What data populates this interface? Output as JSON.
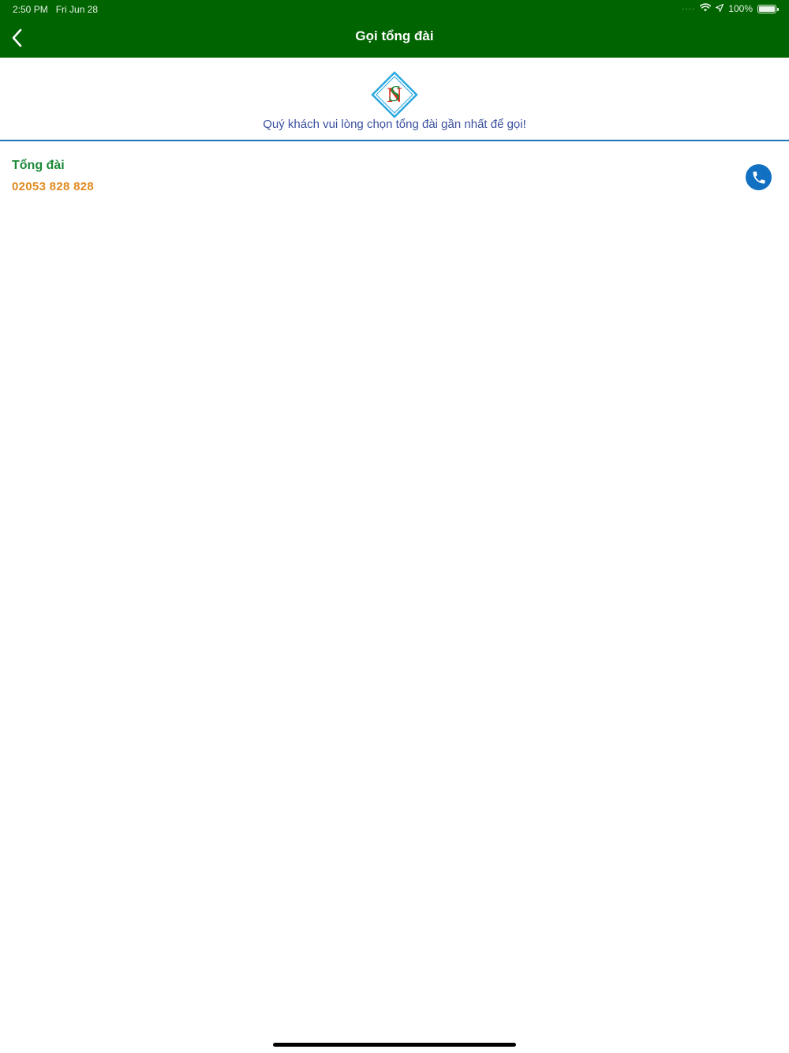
{
  "status_bar": {
    "time": "2:50 PM",
    "date": "Fri Jun 28",
    "battery_text": "100%",
    "icons": [
      "signal-dots-icon",
      "wifi-icon",
      "location-arrow-icon",
      "battery-icon"
    ]
  },
  "nav": {
    "title": "Gọi tổng đài",
    "back_icon": "chevron-left-icon"
  },
  "header": {
    "logo_letters": "SN",
    "instruction": "Quý khách vui lòng chọn tổng đài gần nhất để gọi!"
  },
  "contacts": [
    {
      "name": "Tổng đài",
      "number": "02053 828 828",
      "action_icon": "phone-icon"
    }
  ],
  "colors": {
    "nav_background": "#006400",
    "divider": "#1e73b8",
    "contact_name": "#1d8a3a",
    "contact_number": "#e08a1e",
    "call_button": "#1170c2",
    "instruction": "#3a4f9e"
  }
}
